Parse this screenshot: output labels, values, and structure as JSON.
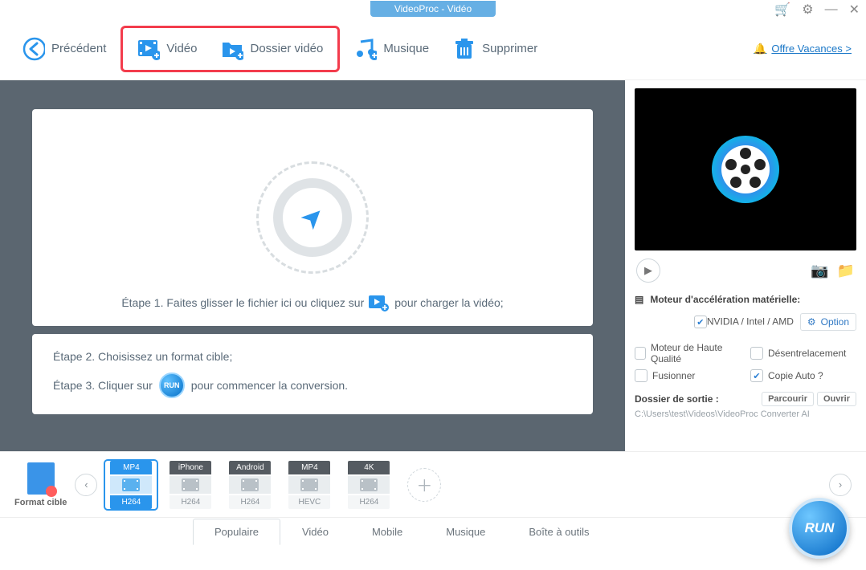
{
  "title": "VideoProc - Vidéo",
  "toolbar": {
    "back": "Précédent",
    "video": "Vidéo",
    "folder": "Dossier vidéo",
    "music": "Musique",
    "delete": "Supprimer",
    "offer": "Offre Vacances >"
  },
  "drop": {
    "step1a": "Étape 1. Faites glisser le fichier ici ou cliquez sur",
    "step1b": "pour charger la vidéo;",
    "step2": "Étape 2. Choisissez un format cible;",
    "step3a": "Étape 3. Cliquer sur",
    "step3b": "pour commencer la conversion.",
    "run": "RUN"
  },
  "right": {
    "hwaccel": "Moteur d'accélération matérielle:",
    "gpu": "NVIDIA / Intel / AMD",
    "option": "Option",
    "hq": "Moteur de Haute Qualité",
    "deint": "Désentrelacement",
    "merge": "Fusionner",
    "autocopy": "Copie Auto ?",
    "outhdr": "Dossier de sortie :",
    "browse": "Parcourir",
    "open": "Ouvrir",
    "outpath": "C:\\Users\\test\\Videos\\VideoProc Converter AI"
  },
  "formats": {
    "label": "Format cible",
    "presets": [
      {
        "top": "MP4",
        "bot": "H264",
        "selected": true
      },
      {
        "top": "iPhone",
        "bot": "H264",
        "selected": false
      },
      {
        "top": "Android",
        "bot": "H264",
        "selected": false
      },
      {
        "top": "MP4",
        "bot": "HEVC",
        "selected": false
      },
      {
        "top": "4K",
        "bot": "H264",
        "selected": false
      }
    ]
  },
  "tabs": [
    "Populaire",
    "Vidéo",
    "Mobile",
    "Musique",
    "Boîte à outils"
  ],
  "activeTab": 0,
  "bigrun": "RUN"
}
